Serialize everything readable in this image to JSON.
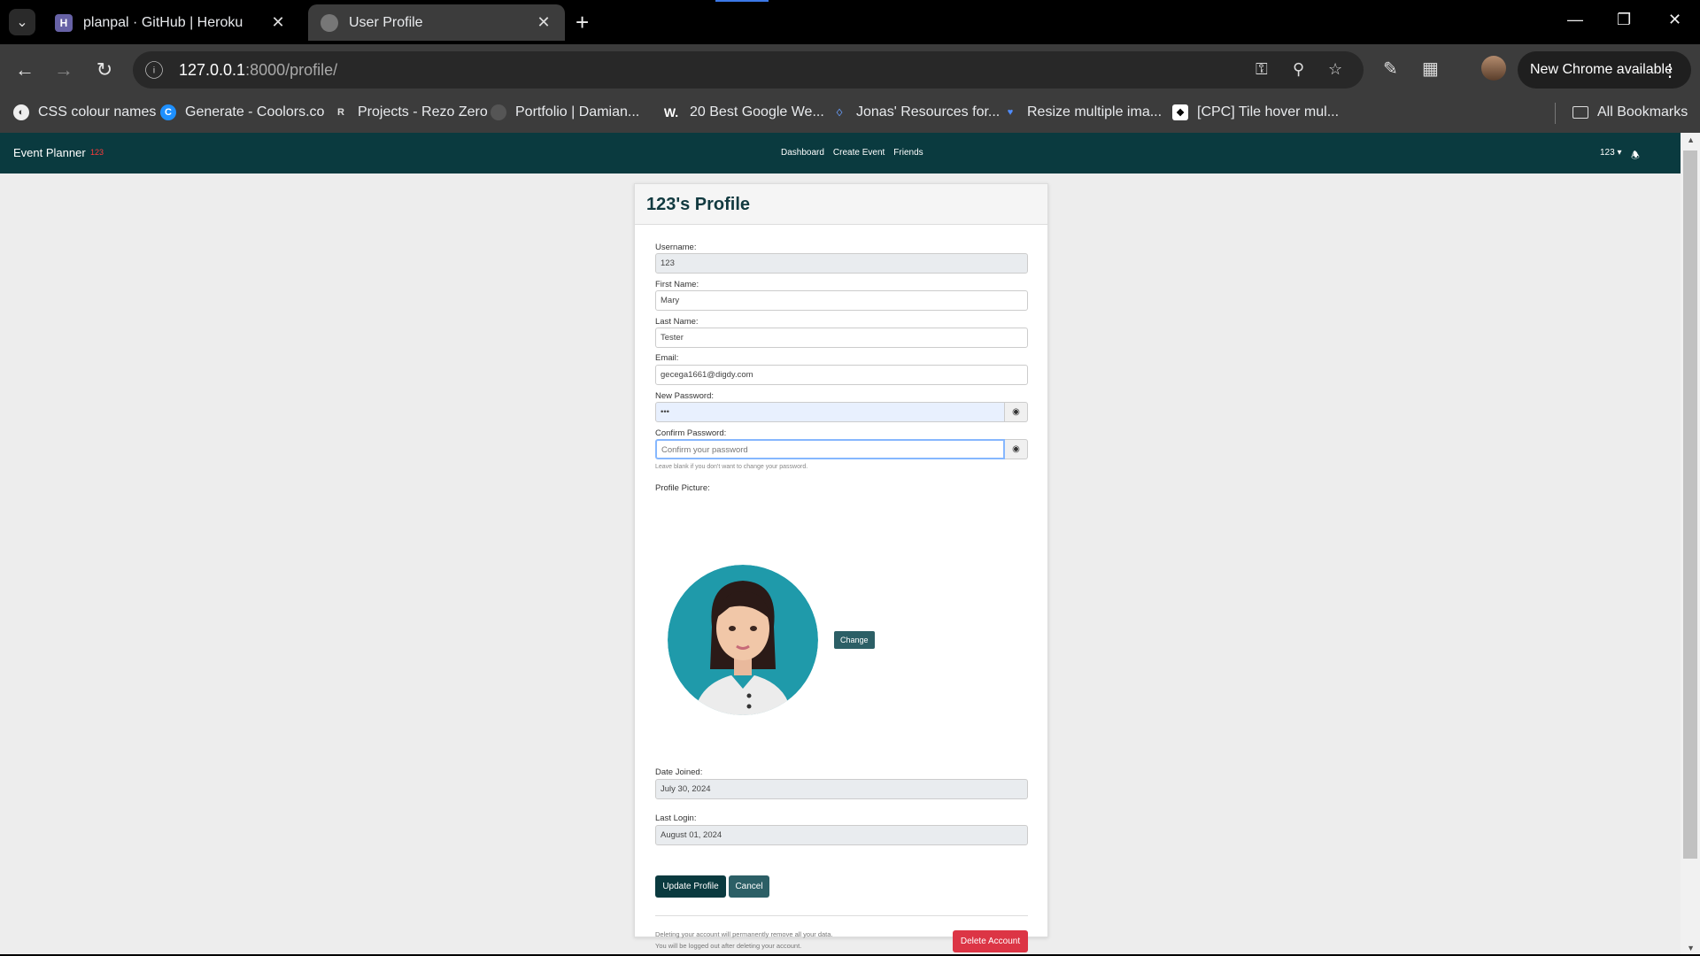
{
  "browser": {
    "tabs": [
      {
        "title": "planpal · GitHub | Heroku",
        "favicon": "H"
      },
      {
        "title": "User Profile"
      }
    ],
    "url_host": "127.0.0.1",
    "url_rest": ":8000/profile/",
    "update_label": "New Chrome available",
    "bookmarks": [
      {
        "label": "CSS colour names"
      },
      {
        "label": "Generate - Coolors.co"
      },
      {
        "label": "Projects - Rezo Zero",
        "icon_text": "R"
      },
      {
        "label": "Portfolio | Damian..."
      },
      {
        "label": "20 Best Google We...",
        "icon_text": "W."
      },
      {
        "label": "Jonas' Resources for..."
      },
      {
        "label": "Resize multiple ima..."
      },
      {
        "label": "[CPC] Tile hover mul..."
      }
    ],
    "all_bookmarks": "All Bookmarks"
  },
  "navbar": {
    "brand": "Event Planner",
    "badge": "123",
    "links": [
      "Dashboard",
      "Create Event",
      "Friends"
    ],
    "user": "123"
  },
  "profile": {
    "title": "123's Profile",
    "username_label": "Username:",
    "username": "123",
    "first_name_label": "First Name:",
    "first_name": "Mary",
    "last_name_label": "Last Name:",
    "last_name": "Tester",
    "email_label": "Email:",
    "email": "gecega1661@digdy.com",
    "new_password_label": "New Password:",
    "new_password_mask": "•••",
    "confirm_password_label": "Confirm Password:",
    "confirm_password_placeholder": "Confirm your password",
    "password_hint": "Leave blank if you don't want to change your password.",
    "picture_label": "Profile Picture:",
    "change_label": "Change",
    "date_joined_label": "Date Joined:",
    "date_joined": "July 30, 2024",
    "last_login_label": "Last Login:",
    "last_login": "August 01, 2024",
    "update_label": "Update Profile",
    "cancel_label": "Cancel",
    "delete_warning_1": "Deleting your account will permanently remove all your data.",
    "delete_warning_2": "You will be logged out after deleting your account.",
    "delete_label": "Delete Account"
  },
  "colors": {
    "navbar": "#0a3a3f",
    "primary": "#0a3a3f",
    "secondary": "#2c5f66",
    "danger": "#dc3545",
    "avatar_bg": "#1f9aaa"
  }
}
